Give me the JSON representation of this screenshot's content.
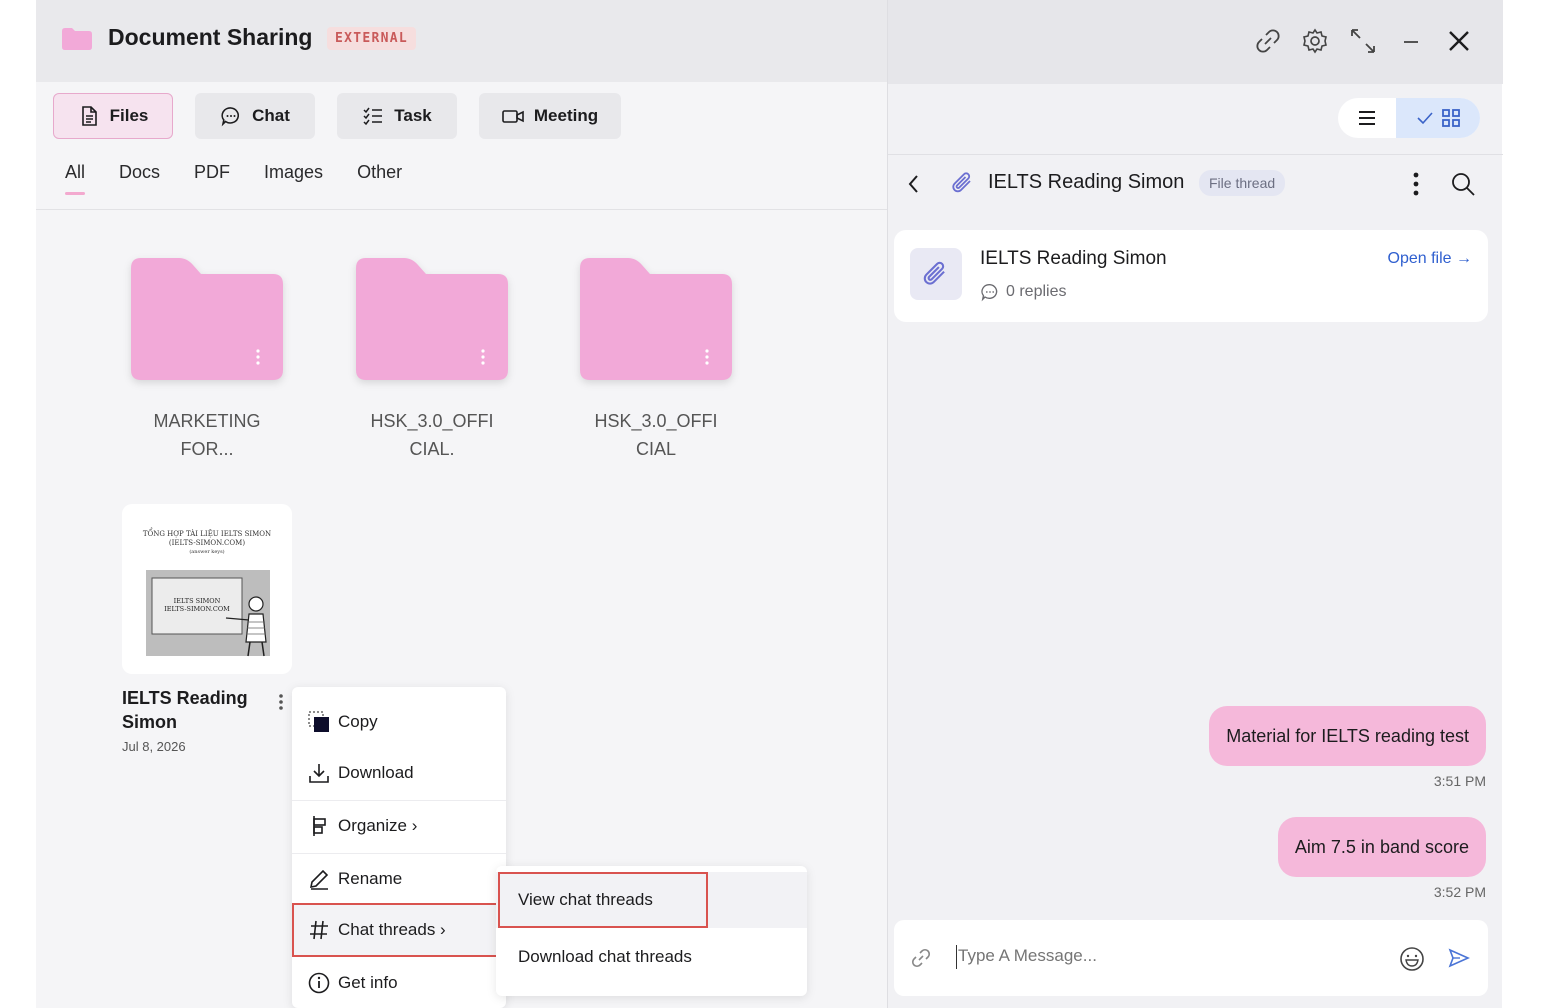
{
  "app": {
    "title": "Document Sharing",
    "badge": "EXTERNAL"
  },
  "tabs": [
    {
      "label": "Files",
      "icon": "file-icon",
      "active": true
    },
    {
      "label": "Chat",
      "icon": "chat-bubble-icon",
      "active": false
    },
    {
      "label": "Task",
      "icon": "checklist-icon",
      "active": false
    },
    {
      "label": "Meeting",
      "icon": "video-icon",
      "active": false
    }
  ],
  "filters": [
    "All",
    "Docs",
    "PDF",
    "Images",
    "Other"
  ],
  "folders": [
    {
      "name_line1": "MARKETING",
      "name_line2": "FOR..."
    },
    {
      "name_line1": "HSK_3.0_OFFI",
      "name_line2": "CIAL."
    },
    {
      "name_line1": "HSK_3.0_OFFI",
      "name_line2": "CIAL"
    }
  ],
  "file": {
    "name_line1": "IELTS Reading",
    "name_line2": "Simon",
    "date": "Jul 8, 2026",
    "thumb_heading_line1": "TỔNG HỢP TÀI LIỆU IELTS SIMON",
    "thumb_heading_line2": "(IELTS-SIMON.COM)",
    "thumb_heading_line3": "(answer keys)",
    "thumb_board_line1": "IELTS SIMON",
    "thumb_board_line2": "IELTS-SIMON.COM"
  },
  "context_menu": {
    "copy": "Copy",
    "download": "Download",
    "organize": "Organize ›",
    "rename": "Rename",
    "chat_threads": "Chat threads ›",
    "get_info": "Get info"
  },
  "submenu": {
    "view": "View chat threads",
    "download": "Download chat threads"
  },
  "thread": {
    "title": "IELTS Reading Simon",
    "badge": "File thread",
    "card_title": "IELTS Reading Simon",
    "replies": "0 replies",
    "open_file": "Open file →"
  },
  "messages": [
    {
      "text": "Material for IELTS reading test",
      "time": "3:51 PM"
    },
    {
      "text": "Aim 7.5 in band score",
      "time": "3:52 PM"
    }
  ],
  "composer": {
    "placeholder": "Type A Message..."
  },
  "colors": {
    "accent_pink": "#f5b8da",
    "folder_pink": "#f2a9d8",
    "link_blue": "#2f5fcf",
    "highlight_red": "#d9534f"
  }
}
